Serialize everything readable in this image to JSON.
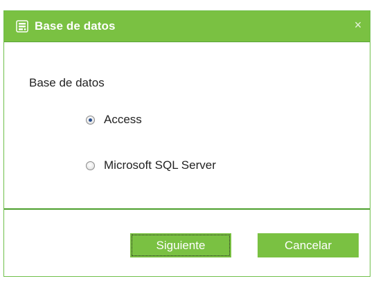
{
  "dialog": {
    "title": "Base de datos",
    "title_icon": "database-settings-icon",
    "close_icon": "close-icon",
    "close_glyph": "×"
  },
  "main": {
    "section_label": "Base de datos",
    "options": [
      {
        "label": "Access",
        "selected": true
      },
      {
        "label": "Microsoft SQL Server",
        "selected": false
      }
    ]
  },
  "footer": {
    "next_label": "Siguiente",
    "cancel_label": "Cancelar"
  },
  "colors": {
    "accent_green": "#7ac142",
    "divider_green": "#4a9e2a",
    "text": "#222222",
    "radio_dot": "#2a4f8e"
  }
}
